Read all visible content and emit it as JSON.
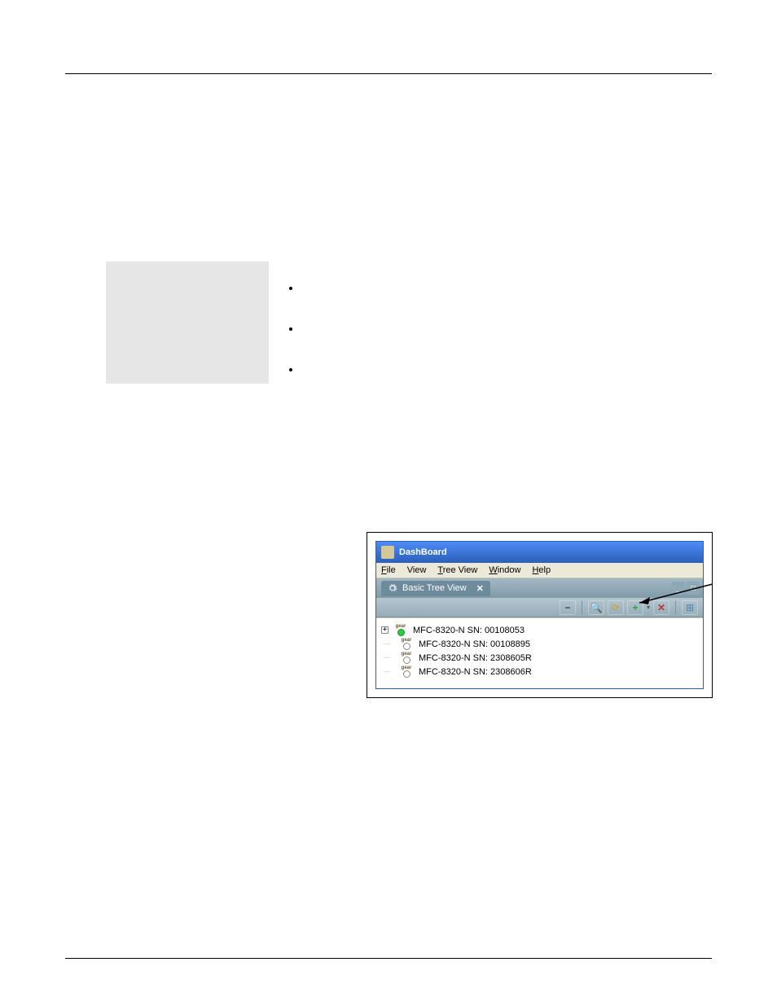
{
  "page": {
    "bullets": [
      "",
      "",
      ""
    ]
  },
  "dashboard": {
    "title": "DashBoard",
    "menu": {
      "file": "File",
      "view": "View",
      "treeview": "Tree View",
      "window": "Window",
      "help": "Help"
    },
    "tab": {
      "label": "Basic Tree View",
      "close": "✕"
    },
    "tabbar_icons": {
      "min": "_",
      "max": "□"
    },
    "toolbar": {
      "collapse": "−",
      "refresh": "⟳",
      "search": "🔍",
      "add": "+",
      "delete": "✕",
      "layout": "⊞"
    },
    "tree_items": [
      {
        "expander": "+",
        "badge": "gear",
        "dot": "green",
        "label": "MFC-8320-N SN: 00108053"
      },
      {
        "expander": "",
        "badge": "gear",
        "dot": "white",
        "label": "MFC-8320-N SN: 00108895"
      },
      {
        "expander": "",
        "badge": "gear",
        "dot": "white",
        "label": "MFC-8320-N SN: 2308605R"
      },
      {
        "expander": "",
        "badge": "gear",
        "dot": "white",
        "label": "MFC-8320-N SN: 2308606R"
      }
    ]
  }
}
